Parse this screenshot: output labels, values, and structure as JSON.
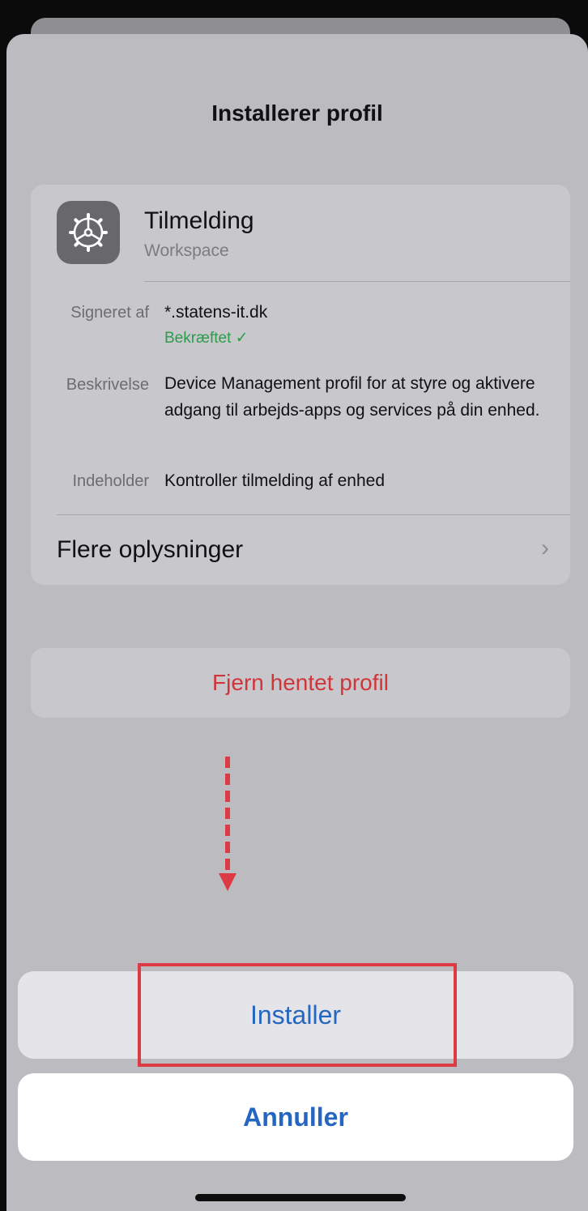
{
  "sheet": {
    "title": "Installerer profil"
  },
  "profile": {
    "name": "Tilmelding",
    "organization": "Workspace",
    "icon": "settings-gear-icon",
    "signed_by_label": "Signeret af",
    "signed_by_value": "*.statens-it.dk",
    "verified_text": "Bekræftet ✓",
    "description_label": "Beskrivelse",
    "description_value": "Device Management profil for at styre og aktivere adgang til arbejds-apps og services på din enhed.",
    "contains_label": "Indeholder",
    "contains_value": "Kontroller tilmelding af enhed",
    "more_info_label": "Flere oplysninger",
    "more_info_chevron": "›"
  },
  "actions": {
    "remove_label": "Fjern hentet profil",
    "install_label": "Installer",
    "cancel_label": "Annuller"
  },
  "colors": {
    "destructive": "#d0353a",
    "accent": "#2466c0",
    "verified": "#2b9c4a",
    "highlight": "#dc3b45"
  }
}
